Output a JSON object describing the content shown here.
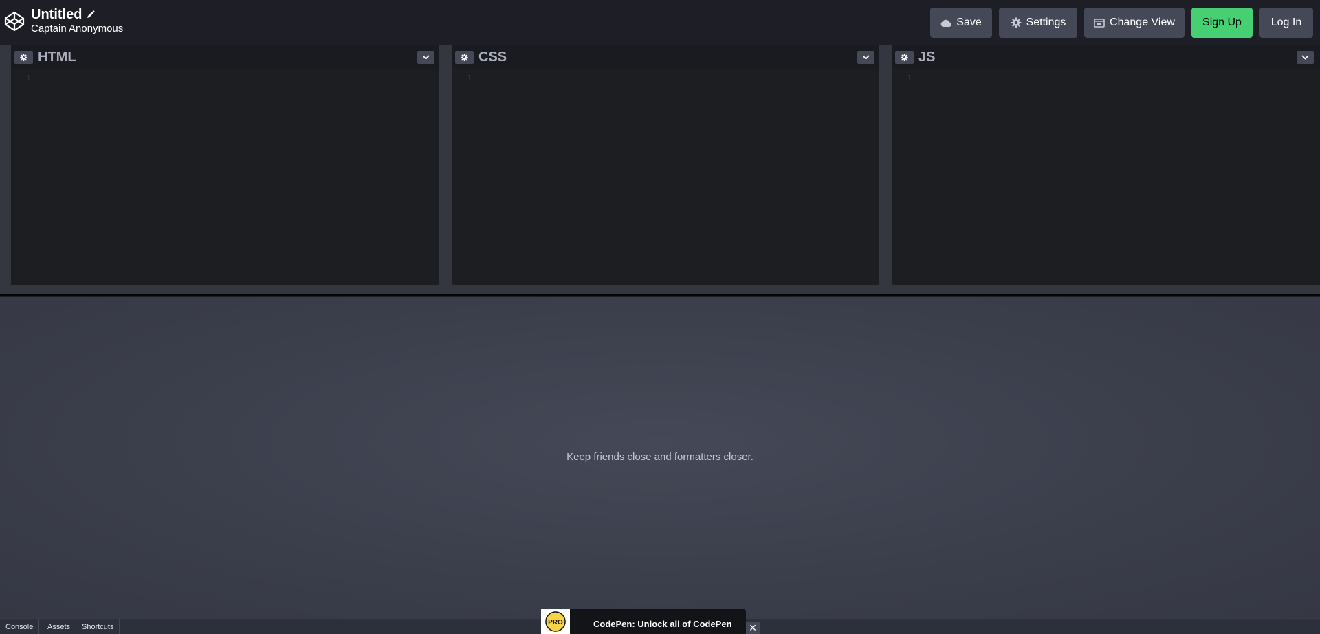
{
  "header": {
    "title": "Untitled",
    "author": "Captain Anonymous",
    "buttons": {
      "save": "Save",
      "settings": "Settings",
      "change_view": "Change View",
      "sign_up": "Sign Up",
      "log_in": "Log In"
    }
  },
  "editors": [
    {
      "label": "HTML",
      "line_number": "1"
    },
    {
      "label": "CSS",
      "line_number": "1"
    },
    {
      "label": "JS",
      "line_number": "1"
    }
  ],
  "preview": {
    "message": "Keep friends close and formatters closer."
  },
  "footer": {
    "tabs": [
      "Console",
      "Assets",
      "Shortcuts"
    ]
  },
  "promo": {
    "badge": "PRO",
    "text": "CodePen: Unlock all of CodePen",
    "close": "✕"
  },
  "colors": {
    "background": "#1e1f26",
    "button": "#444857",
    "accent_green": "#47cf73",
    "editor_bg": "#1d1e22",
    "pro_yellow": "#f5d547"
  },
  "icons": [
    "codepen-logo-icon",
    "pencil-icon",
    "cloud-icon",
    "gear-icon",
    "change-view-icon",
    "chevron-down-icon",
    "close-icon"
  ]
}
